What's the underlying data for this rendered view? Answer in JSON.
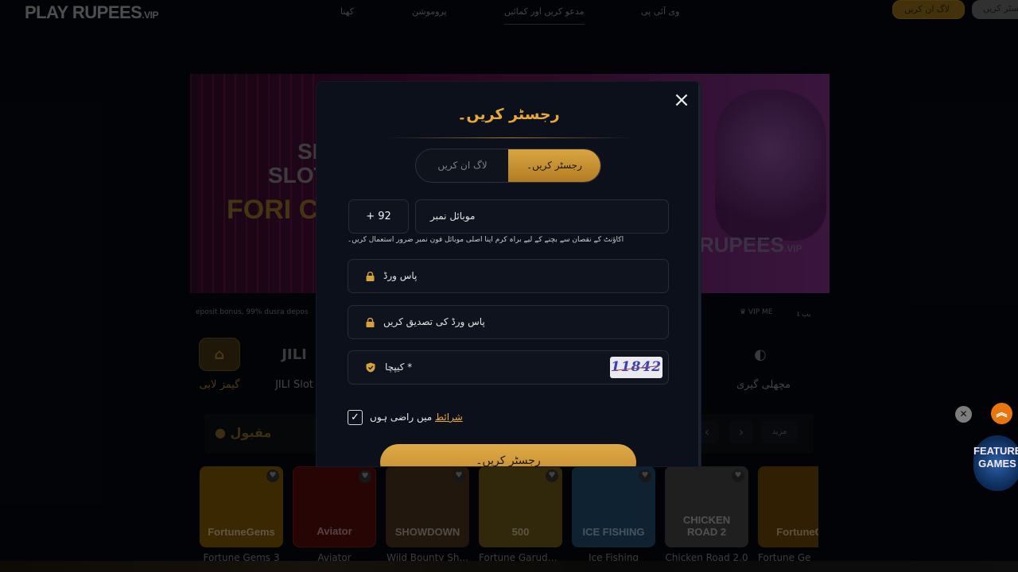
{
  "header": {
    "logo": "PLAY RUPEES",
    "logo_suffix": ".VIP",
    "nav": [
      "کھنا",
      "پروموشن",
      "مدعو کریں اور کمائیں",
      "وی آئی پی"
    ],
    "login_label": "لاگ ان کریں",
    "register_label": "رجسٹر کریں"
  },
  "banner": {
    "line1": "SL",
    "line2": "SLOT",
    "line3": "FORI C",
    "logo": "RUPEES",
    "logo_suffix": ".VIP"
  },
  "ticker": {
    "left": "eposit bonus, 99% dusra depos",
    "vip": "VIP ME",
    "app": "یپ"
  },
  "categories": [
    {
      "label": "گیمز لابی",
      "icon": "home-icon"
    },
    {
      "label": "JILI Slot",
      "icon": "JILI"
    },
    {
      "label": "مچھلی گیری",
      "icon": "fish-icon"
    }
  ],
  "popular": {
    "title": "مقبول",
    "more": "مزید"
  },
  "games": [
    {
      "name": "Fortune Gems 3",
      "art": "FortuneGems",
      "color": "#6b4a06"
    },
    {
      "name": "Aviator",
      "art": "Aviator",
      "color": "#4a0a0a"
    },
    {
      "name": "Wild Bounty Sh...",
      "art": "SHOWDOWN",
      "color": "#3d2a18"
    },
    {
      "name": "Fortune Garuda...",
      "art": "500",
      "color": "#5a4a14"
    },
    {
      "name": "Ice Fishing",
      "art": "ICE FISHING",
      "color": "#1d3f5c"
    },
    {
      "name": "Chicken Road 2.0",
      "art": "CHICKEN ROAD 2",
      "color": "#3a3a3a"
    },
    {
      "name": "Fortune Ge",
      "art": "FortuneG",
      "color": "#5a3a06"
    }
  ],
  "widgets": {
    "featured": "FEATURED GAMES"
  },
  "modal": {
    "title": "رجسٹر کریں۔",
    "tab_login": "لاگ ان کریں",
    "tab_register": "رجسٹر کریں۔",
    "country_code": "+ 92",
    "mobile_placeholder": "موبائل نمبر",
    "hint": "اکاؤنٹ کے نقصان سے بچنے کے لیے براہ کرم اپنا اصلی موبائل فون نمبر ضرور استعمال کریں۔",
    "password_placeholder": "پاس ورڈ",
    "confirm_placeholder": "پاس ورڈ کی تصدیق کریں",
    "captcha_placeholder": "کیپچا *",
    "captcha_code": "11842",
    "agree_prefix": "میں راضی ہوں",
    "agree_terms": "شرائط",
    "submit": "رجسٹر کریں۔"
  },
  "colors": {
    "accent": "#e8a73a",
    "modal_bg": "#0b101b",
    "field_bg": "#0e131d"
  }
}
